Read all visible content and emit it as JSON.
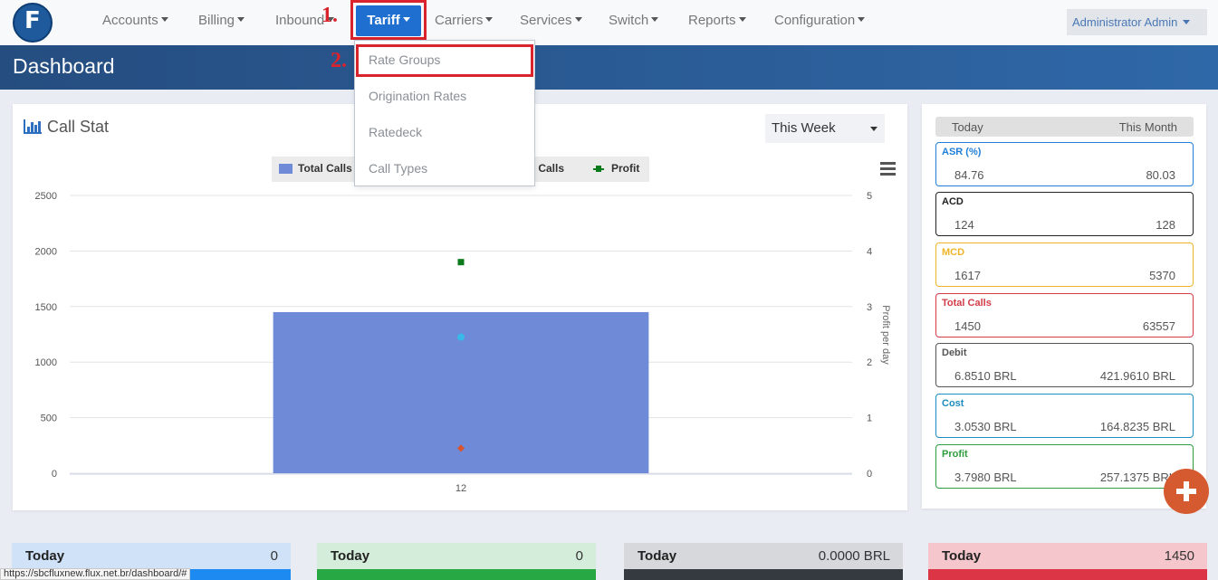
{
  "nav": {
    "items": [
      "Accounts",
      "Billing",
      "Inbound",
      "Carriers",
      "Services",
      "Switch",
      "Reports",
      "Configuration"
    ],
    "active": "Tariff",
    "user": "Administrator Admin"
  },
  "annotations": {
    "step1": "1.",
    "step2": "2."
  },
  "header": {
    "title": "Dashboard"
  },
  "tariff_menu": [
    "Rate Groups",
    "Origination Rates",
    "Ratedeck",
    "Call Types"
  ],
  "callstat": {
    "title": "Call Stat",
    "period": "This Week",
    "legend": {
      "total": "Total Calls",
      "answered": "ed Calls",
      "profit": "Profit"
    },
    "y_right_label": "Profit per day"
  },
  "chart_data": {
    "type": "bar",
    "categories": [
      "12"
    ],
    "series": [
      {
        "name": "Total Calls",
        "values": [
          1450
        ],
        "axis": "left",
        "color": "#6f8ad6"
      },
      {
        "name": "Profit",
        "values": [
          3.8
        ],
        "axis": "right",
        "color": "#0a7a1a"
      },
      {
        "name": "",
        "values": [
          2.45
        ],
        "axis": "right",
        "color": "#39b8ea"
      },
      {
        "name": "",
        "values": [
          0.45
        ],
        "axis": "right",
        "color": "#d9532d"
      }
    ],
    "ylim_left": [
      0,
      2500
    ],
    "yticks_left": [
      "2500",
      "2000",
      "1500",
      "1000",
      "500",
      "0"
    ],
    "ylim_right": [
      0,
      5
    ],
    "yticks_right": [
      "5",
      "4",
      "3",
      "2",
      "1",
      "0"
    ],
    "ylabel_right": "Profit per day",
    "grid": true,
    "legend": "top"
  },
  "stats": {
    "col_today": "Today",
    "col_month": "This Month",
    "items": [
      {
        "label": "ASR (%)",
        "today": "84.76",
        "month": "80.03",
        "color": "#1f7fd8"
      },
      {
        "label": "ACD",
        "today": "124",
        "month": "128",
        "color": "#222222"
      },
      {
        "label": "MCD",
        "today": "1617",
        "month": "5370",
        "color": "#f0b429"
      },
      {
        "label": "Total Calls",
        "today": "1450",
        "month": "63557",
        "color": "#d23b47"
      },
      {
        "label": "Debit",
        "today": "6.8510 BRL",
        "month": "421.9610 BRL",
        "color": "#555555"
      },
      {
        "label": "Cost",
        "today": "3.0530 BRL",
        "month": "164.8235 BRL",
        "color": "#1d8bbf"
      },
      {
        "label": "Profit",
        "today": "3.7980 BRL",
        "month": "257.1375 BRL",
        "color": "#2e9d3e"
      }
    ]
  },
  "bottom_cards": [
    {
      "title": "Today",
      "value": "0",
      "head": "#cfe2f7",
      "bar": "#1c8af0"
    },
    {
      "title": "Today",
      "value": "0",
      "head": "#d4edda",
      "bar": "#28a745"
    },
    {
      "title": "Today",
      "value": "0.0000 BRL",
      "head": "#d6d8db",
      "bar": "#343a40"
    },
    {
      "title": "Today",
      "value": "1450",
      "head": "#f5c6cb",
      "bar": "#dc3545"
    }
  ],
  "statusbar": "https://sbcfluxnew.flux.net.br/dashboard/#"
}
